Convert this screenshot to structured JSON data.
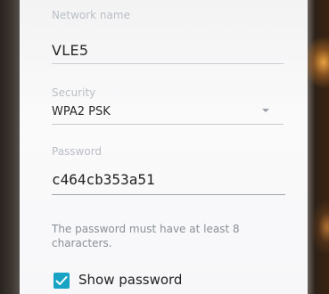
{
  "network": {
    "label": "Network name",
    "value": "VLE5"
  },
  "security": {
    "label": "Security",
    "value": "WPA2 PSK"
  },
  "password": {
    "label": "Password",
    "value": "c464cb353a51",
    "hint": "The password must have at least 8 characters."
  },
  "show_password": {
    "label": "Show password",
    "checked": true
  },
  "colors": {
    "accent": "#18a3c4"
  }
}
